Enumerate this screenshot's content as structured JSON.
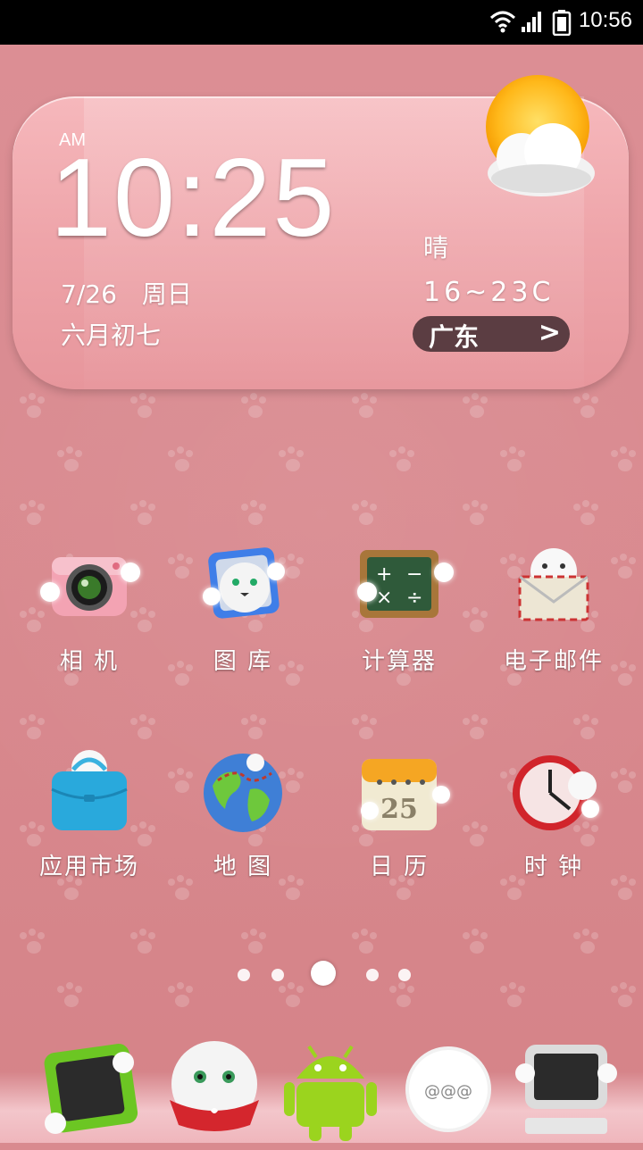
{
  "status_bar": {
    "time": "10:56"
  },
  "widget": {
    "ampm": "AM",
    "time": "10:25",
    "date": "7/26　周日",
    "lunar": "六月初七",
    "weather": "晴",
    "temp": "16~23C",
    "city": "广东",
    "city_arrow": ">"
  },
  "apps": [
    {
      "label": "相 机",
      "icon": "camera-icon"
    },
    {
      "label": "图 库",
      "icon": "gallery-icon"
    },
    {
      "label": "计算器",
      "icon": "calculator-icon"
    },
    {
      "label": "电子邮件",
      "icon": "email-icon"
    },
    {
      "label": "应用市场",
      "icon": "app-market-icon"
    },
    {
      "label": "地 图",
      "icon": "map-icon"
    },
    {
      "label": "日 历",
      "icon": "calendar-icon"
    },
    {
      "label": "时 钟",
      "icon": "clock-icon"
    }
  ],
  "calendar_icon_day": "25",
  "page_indicator": {
    "pages": 5,
    "current": 3
  },
  "dock": [
    "phone-icon",
    "contacts-icon",
    "android-icon",
    "messages-icon",
    "browser-icon"
  ],
  "colors": {
    "wallpaper": "#d98a8f",
    "widget": "#eea4a9",
    "city_pill": "#5b3d42"
  }
}
